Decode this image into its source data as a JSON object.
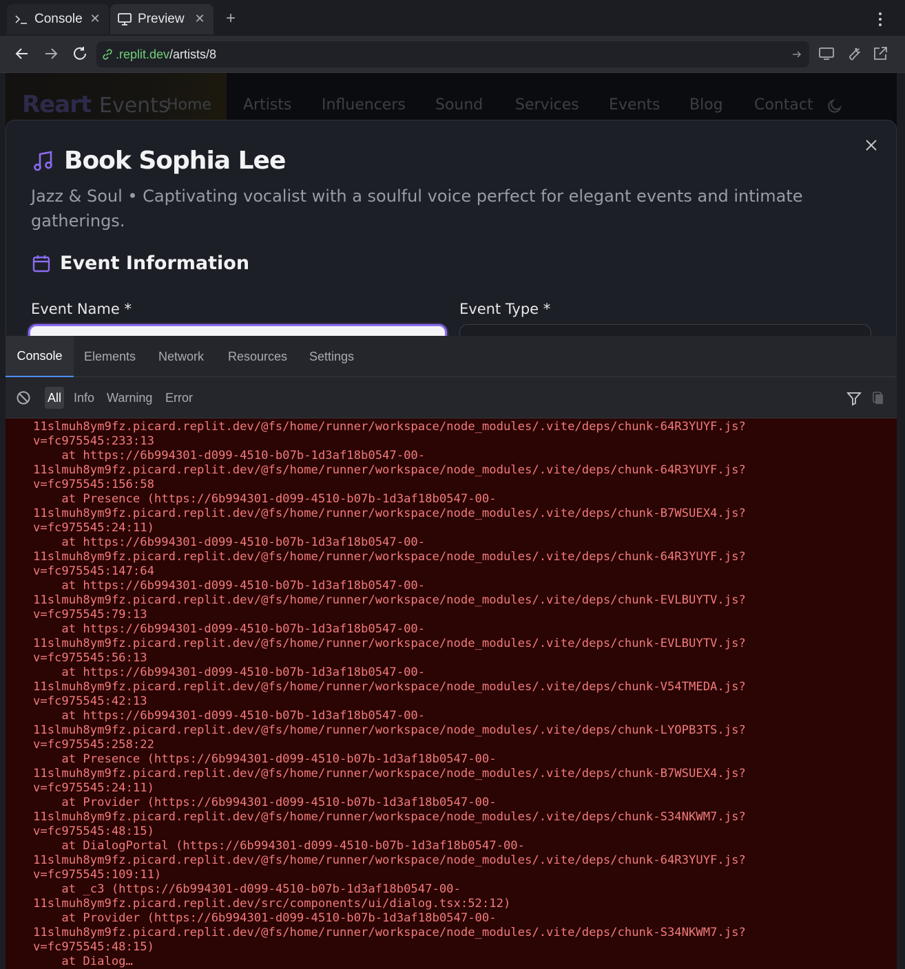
{
  "tabs": [
    {
      "label": "Console",
      "icon": "terminal-icon"
    },
    {
      "label": "Preview",
      "icon": "monitor-icon"
    }
  ],
  "address": {
    "domain": ".replit.dev",
    "path": "/artists/8"
  },
  "site": {
    "logo_word": "Reart",
    "logo_events": "Events",
    "nav": [
      "Home",
      "Artists",
      "Influencers",
      "Sound",
      "Services",
      "Events",
      "Blog",
      "Contact"
    ]
  },
  "modal": {
    "title": "Book Sophia Lee",
    "description": "Jazz & Soul • Captivating vocalist with a soulful voice perfect for elegant events and intimate gatherings.",
    "section_title": "Event Information",
    "event_name_label": "Event Name *",
    "event_type_label": "Event Type *",
    "accent_color": "#8b6cf0"
  },
  "devtools": {
    "tabs": [
      "Console",
      "Elements",
      "Network",
      "Resources",
      "Settings"
    ],
    "active_tab": "Console",
    "levels": [
      "All",
      "Info",
      "Warning",
      "Error"
    ],
    "active_level": "All",
    "error_color": "#f27b7b",
    "console_lines": [
      "11slmuh8ym9fz.picard.replit.dev/@fs/home/runner/workspace/node_modules/.vite/deps/chunk-64R3YUYF.js?",
      "v=fc975545:233:13",
      "    at https://6b994301-d099-4510-b07b-1d3af18b0547-00-",
      "11slmuh8ym9fz.picard.replit.dev/@fs/home/runner/workspace/node_modules/.vite/deps/chunk-64R3YUYF.js?",
      "v=fc975545:156:58",
      "    at Presence (https://6b994301-d099-4510-b07b-1d3af18b0547-00-",
      "11slmuh8ym9fz.picard.replit.dev/@fs/home/runner/workspace/node_modules/.vite/deps/chunk-B7WSUEX4.js?",
      "v=fc975545:24:11)",
      "    at https://6b994301-d099-4510-b07b-1d3af18b0547-00-",
      "11slmuh8ym9fz.picard.replit.dev/@fs/home/runner/workspace/node_modules/.vite/deps/chunk-64R3YUYF.js?",
      "v=fc975545:147:64",
      "    at https://6b994301-d099-4510-b07b-1d3af18b0547-00-",
      "11slmuh8ym9fz.picard.replit.dev/@fs/home/runner/workspace/node_modules/.vite/deps/chunk-EVLBUYTV.js?",
      "v=fc975545:79:13",
      "    at https://6b994301-d099-4510-b07b-1d3af18b0547-00-",
      "11slmuh8ym9fz.picard.replit.dev/@fs/home/runner/workspace/node_modules/.vite/deps/chunk-EVLBUYTV.js?",
      "v=fc975545:56:13",
      "    at https://6b994301-d099-4510-b07b-1d3af18b0547-00-",
      "11slmuh8ym9fz.picard.replit.dev/@fs/home/runner/workspace/node_modules/.vite/deps/chunk-V54TMEDA.js?",
      "v=fc975545:42:13",
      "    at https://6b994301-d099-4510-b07b-1d3af18b0547-00-",
      "11slmuh8ym9fz.picard.replit.dev/@fs/home/runner/workspace/node_modules/.vite/deps/chunk-LYOPB3TS.js?",
      "v=fc975545:258:22",
      "    at Presence (https://6b994301-d099-4510-b07b-1d3af18b0547-00-",
      "11slmuh8ym9fz.picard.replit.dev/@fs/home/runner/workspace/node_modules/.vite/deps/chunk-B7WSUEX4.js?",
      "v=fc975545:24:11)",
      "    at Provider (https://6b994301-d099-4510-b07b-1d3af18b0547-00-",
      "11slmuh8ym9fz.picard.replit.dev/@fs/home/runner/workspace/node_modules/.vite/deps/chunk-S34NKWM7.js?",
      "v=fc975545:48:15)",
      "    at DialogPortal (https://6b994301-d099-4510-b07b-1d3af18b0547-00-",
      "11slmuh8ym9fz.picard.replit.dev/@fs/home/runner/workspace/node_modules/.vite/deps/chunk-64R3YUYF.js?",
      "v=fc975545:109:11)",
      "    at _c3 (https://6b994301-d099-4510-b07b-1d3af18b0547-00-",
      "11slmuh8ym9fz.picard.replit.dev/src/components/ui/dialog.tsx:52:12)",
      "    at Provider (https://6b994301-d099-4510-b07b-1d3af18b0547-00-",
      "11slmuh8ym9fz.picard.replit.dev/@fs/home/runner/workspace/node_modules/.vite/deps/chunk-S34NKWM7.js?",
      "v=fc975545:48:15)",
      "    at Dialog…"
    ]
  }
}
